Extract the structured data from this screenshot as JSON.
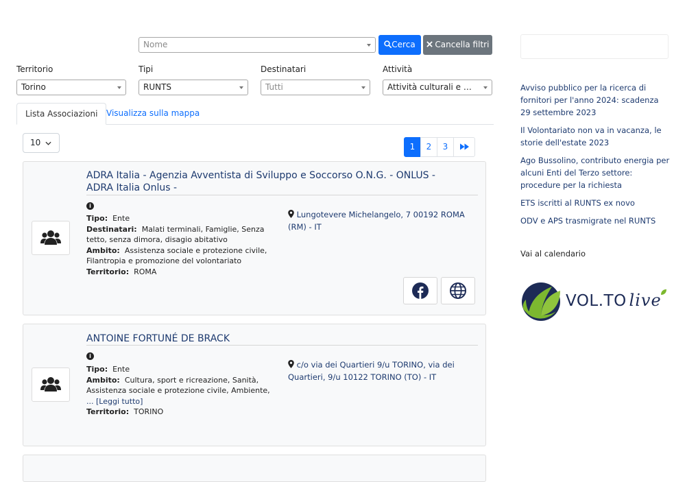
{
  "search": {
    "name_placeholder": "Nome",
    "search_label": "Cerca",
    "clear_label": "Cancella filtri",
    "colors": {
      "primary": "#0d6efd",
      "secondary": "#6c757d"
    }
  },
  "filters": [
    {
      "label": "Territorio",
      "value": "Torino",
      "placeholder": false
    },
    {
      "label": "Tipi",
      "value": "RUNTS",
      "placeholder": false
    },
    {
      "label": "Destinatari",
      "value": "Tutti",
      "placeholder": true
    },
    {
      "label": "Attività",
      "value": "Attività culturali e artisti...",
      "placeholder": false
    }
  ],
  "tabs": [
    {
      "label": "Lista Associazioni",
      "active": true
    },
    {
      "label": "Visualizza sulla mappa",
      "active": false
    }
  ],
  "page_size": "10",
  "pagination": {
    "pages": [
      "1",
      "2",
      "3"
    ],
    "current": "1",
    "last_icon": "fast-forward-icon"
  },
  "associations": [
    {
      "title": "ADRA Italia - Agenzia Avventista di Sviluppo e Soccorso O.N.G. - ONLUS - ADRA Italia Onlus -",
      "tipo_label": "Tipo:",
      "tipo": "Ente",
      "destinatari_label": "Destinatari:",
      "destinatari": "Malati terminali, Famiglie, Senza tetto, senza dimora, disagio abitativo",
      "ambito_label": "Ambito:",
      "ambito": "Assistenza sociale e protezione civile, Filantropia e promozione del volontariato",
      "territorio_label": "Territorio:",
      "territorio": "ROMA",
      "address": "Lungotevere Michelangelo, 7 00192 ROMA (RM) - IT",
      "icons": [
        "users-icon",
        "info-icon",
        "map-marker-icon",
        "facebook-icon",
        "globe-icon"
      ]
    },
    {
      "title": "ANTOINE FORTUNÉ DE BRACK",
      "tipo_label": "Tipo:",
      "tipo": "Ente",
      "ambito_label": "Ambito:",
      "ambito": "Cultura, sport e ricreazione, Sanità, Assistenza sociale e protezione civile, Ambiente,",
      "read_more": "... [Leggi tutto]",
      "territorio_label": "Territorio:",
      "territorio": "TORINO",
      "address": "c/o via dei Quartieri 9/u TORINO, via dei Quartieri, 9/u 10122 TORINO (TO) - IT",
      "icons": [
        "users-icon",
        "info-icon",
        "map-marker-icon"
      ]
    }
  ],
  "sidebar": {
    "news": [
      "Avviso pubblico per la ricerca di fornitori per l'anno 2024: scadenza 29 settembre 2023",
      "Il Volontariato non va in vacanza, le storie dell'estate 2023",
      "Ago Bussolino, contributo energia per alcuni Enti del Terzo settore: procedure per la richiesta",
      "ETS iscritti al RUNTS ex novo",
      "ODV e APS trasmigrate nel RUNTS"
    ],
    "calendar_link": "Vai al calendario",
    "logo": {
      "part1": "VOL.TO",
      "part2": "live",
      "colors": {
        "navy": "#1d2b56",
        "green": "#7cb82f"
      }
    }
  }
}
